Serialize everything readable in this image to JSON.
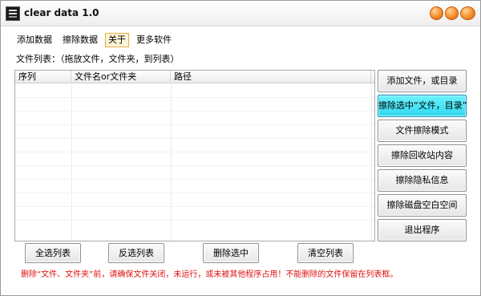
{
  "window": {
    "title": "clear data 1.0",
    "accent_color": "#f7921e"
  },
  "menu": [
    {
      "label": "添加数据"
    },
    {
      "label": "擦除数据"
    },
    {
      "label": "关于",
      "active": true
    },
    {
      "label": "更多软件"
    }
  ],
  "file_list": {
    "label": "文件列表：（拖放文件，文件夹，到列表）",
    "columns": [
      "序列",
      "文件名or文件夹",
      "路径"
    ],
    "rows": []
  },
  "side_buttons": [
    {
      "label": "添加文件，或目录"
    },
    {
      "label": "擦除选中“文件，目录”",
      "highlight_color": "#2fd8f0"
    },
    {
      "label": "文件擦除模式"
    },
    {
      "label": "擦除回收站内容"
    },
    {
      "label": "擦除隐私信息"
    },
    {
      "label": "擦除磁盘空白空间"
    },
    {
      "label": "退出程序"
    }
  ],
  "bottom_buttons": [
    {
      "label": "全选列表"
    },
    {
      "label": "反选列表"
    },
    {
      "label": "删除选中"
    },
    {
      "label": "清空列表"
    }
  ],
  "warning": {
    "text": "删除“文件、文件夹”前，请确保文件关闭，未运行，或未被其他程序占用！不能删除的文件保留在列表框。",
    "color": "#e01010"
  }
}
